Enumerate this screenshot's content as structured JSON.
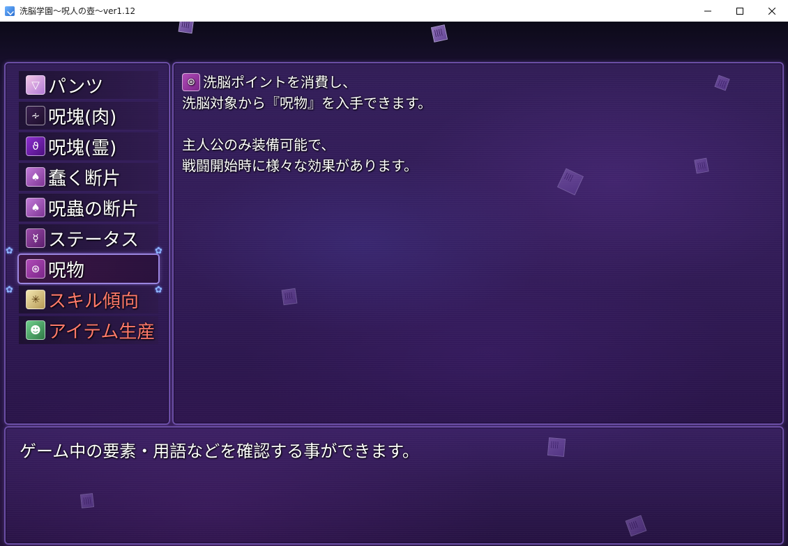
{
  "window": {
    "title": "洗脳学園～呪人の壺～ver1.12",
    "controls": {
      "minimize": "minimize",
      "maximize": "maximize",
      "close": "close"
    }
  },
  "menu": {
    "items": [
      {
        "label": "パンツ",
        "icon": "panties-icon",
        "color": "#ffffff",
        "selected": false
      },
      {
        "label": "呪塊(肉)",
        "icon": "curse-flesh-icon",
        "color": "#ffffff",
        "selected": false
      },
      {
        "label": "呪塊(霊)",
        "icon": "curse-spirit-icon",
        "color": "#ffffff",
        "selected": false
      },
      {
        "label": "蠢く断片",
        "icon": "writhing-fragment-icon",
        "color": "#ffffff",
        "selected": false
      },
      {
        "label": "呪蟲の断片",
        "icon": "curse-bug-fragment-icon",
        "color": "#ffffff",
        "selected": false
      },
      {
        "label": "ステータス",
        "icon": "status-icon",
        "color": "#ffffff",
        "selected": false
      },
      {
        "label": "呪物",
        "icon": "cursed-item-icon",
        "color": "#ffffff",
        "selected": true
      },
      {
        "label": "スキル傾向",
        "icon": "skill-tendency-icon",
        "color": "#ff7a6b",
        "selected": false
      },
      {
        "label": "アイテム生産",
        "icon": "item-production-icon",
        "color": "#ff7a6b",
        "selected": false
      }
    ]
  },
  "help": {
    "lines": [
      "洗脳ポイントを消費し、",
      "洗脳対象から『呪物』を入手できます。",
      "",
      "主人公のみ装備可能で、",
      "戦闘開始時に様々な効果があります。"
    ],
    "icon": "cursed-item-icon"
  },
  "message": {
    "text": "ゲーム中の要素・用語などを確認する事ができます。"
  },
  "colors": {
    "accent": "#6c4ea6",
    "highlight_text": "#ff7a6b",
    "selection_border": "#9b86e0"
  }
}
